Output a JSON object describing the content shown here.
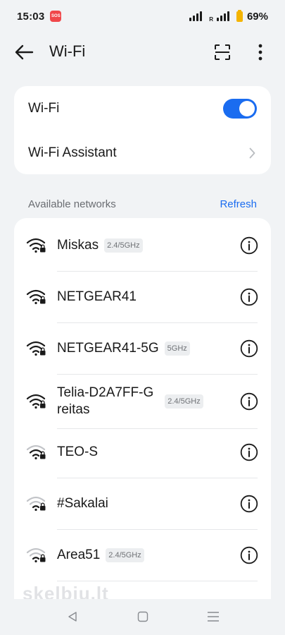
{
  "status_bar": {
    "time": "15:03",
    "sos_label": "SOS",
    "roaming_label": "R",
    "battery_percent": "69%",
    "battery_color": "#f4b400"
  },
  "app_bar": {
    "title": "Wi-Fi",
    "back_icon": "arrow-left-icon",
    "scan_icon": "scan-frame-icon",
    "more_icon": "more-vertical-icon"
  },
  "settings": {
    "wifi_label": "Wi-Fi",
    "wifi_enabled": true,
    "assistant_label": "Wi-Fi Assistant"
  },
  "networks_section": {
    "title": "Available networks",
    "refresh_label": "Refresh"
  },
  "networks": [
    {
      "name": "Miskas",
      "band": "2.4/5GHz",
      "signal": "full",
      "locked": true
    },
    {
      "name": "NETGEAR41",
      "band": "",
      "signal": "full",
      "locked": true
    },
    {
      "name": "NETGEAR41-5G",
      "band": "5GHz",
      "signal": "full",
      "locked": true
    },
    {
      "name": "Telia-D2A7FF-G",
      "name_line2": "reitas",
      "band": "2.4/5GHz",
      "signal": "high",
      "locked": true
    },
    {
      "name": "TEO-S",
      "band": "",
      "signal": "medium",
      "locked": true
    },
    {
      "name": "#Sakalai",
      "band": "",
      "signal": "low",
      "locked": true
    },
    {
      "name": "Area51",
      "band": "2.4/5GHz",
      "signal": "low",
      "locked": true
    }
  ],
  "watermark": "skelbiu.lt",
  "nav": {
    "back_icon": "nav-back-triangle-icon",
    "home_icon": "nav-home-square-icon",
    "recents_icon": "nav-recents-lines-icon"
  },
  "colors": {
    "accent": "#1a6cf0",
    "background": "#f1f3f5",
    "card": "#ffffff"
  }
}
